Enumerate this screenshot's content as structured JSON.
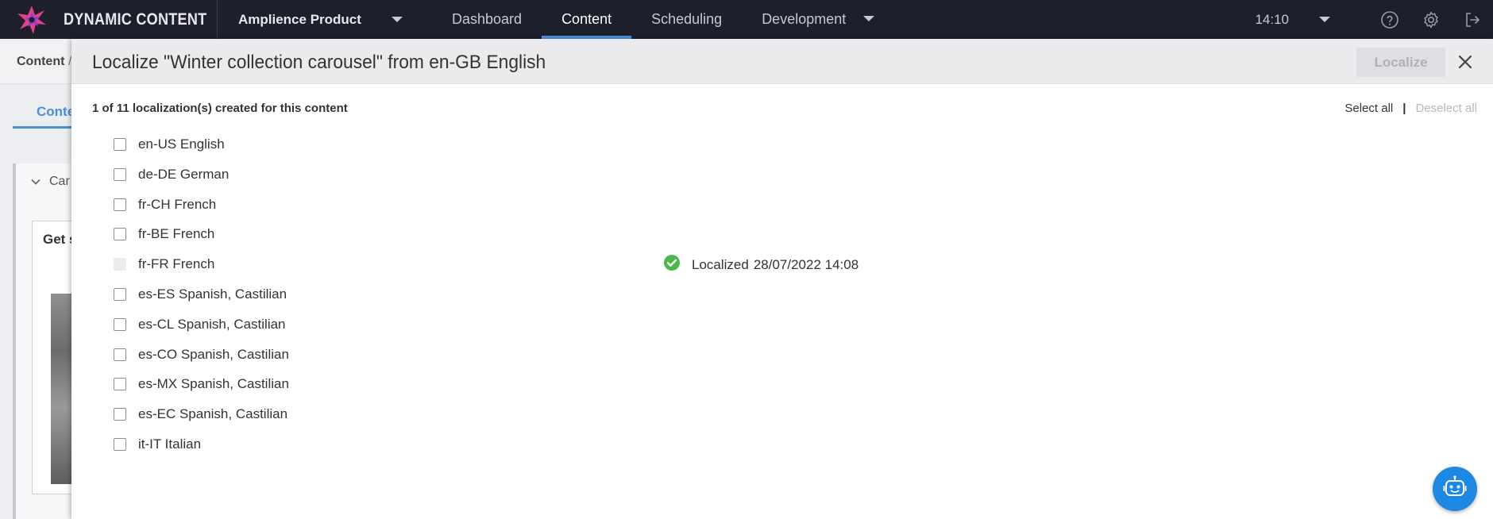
{
  "app": {
    "brand_name": "DYNAMIC CONTENT",
    "hub": "Amplience Product",
    "nav_tabs": [
      "Dashboard",
      "Content",
      "Scheduling",
      "Development"
    ],
    "active_tab": "Content",
    "clock": "14:10",
    "accent_color": "#4a90d9"
  },
  "background": {
    "breadcrumb": "Content",
    "breadcrumb_sep": "/",
    "tab_fragment": "Conte",
    "card_label_fragment": "Car",
    "card_title_fragment": "Get s"
  },
  "dialog": {
    "title": "Localize \"Winter collection carousel\" from en-GB English",
    "localize_label": "Localize",
    "summary": "1 of 11 localization(s) created for this content",
    "select_all": "Select all",
    "separator": "|",
    "deselect_all": "Deselect all",
    "locales": [
      {
        "label": "en-US English"
      },
      {
        "label": "de-DE German"
      },
      {
        "label": "fr-CH French"
      },
      {
        "label": "fr-BE French"
      },
      {
        "label": "fr-FR French",
        "status": "Localized",
        "date": "28/07/2022 14:08"
      },
      {
        "label": "es-ES Spanish, Castilian"
      },
      {
        "label": "es-CL Spanish, Castilian"
      },
      {
        "label": "es-CO Spanish, Castilian"
      },
      {
        "label": "es-MX Spanish, Castilian"
      },
      {
        "label": "es-EC Spanish, Castilian"
      },
      {
        "label": "it-IT Italian"
      }
    ],
    "success_color": "#4cb84c"
  }
}
